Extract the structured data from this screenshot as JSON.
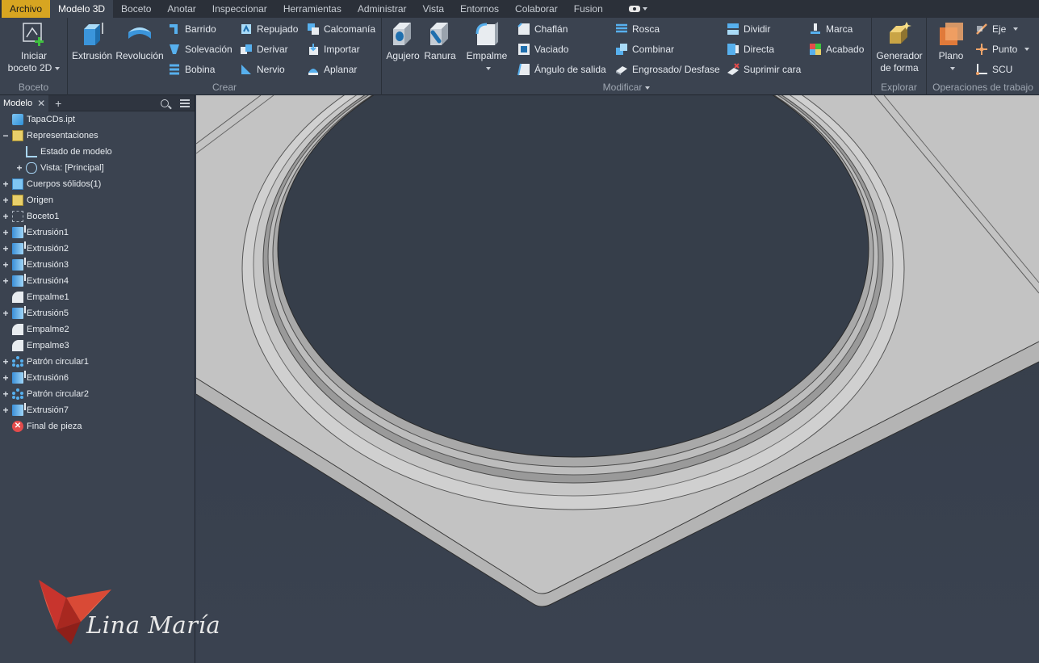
{
  "menu": {
    "tabs": [
      "Archivo",
      "Modelo 3D",
      "Boceto",
      "Anotar",
      "Inspeccionar",
      "Herramientas",
      "Administrar",
      "Vista",
      "Entornos",
      "Colaborar",
      "Fusion"
    ],
    "active_tab": "Modelo 3D",
    "extra_icon": "camera-icon"
  },
  "ribbon": {
    "boceto": {
      "title": "Boceto",
      "start_sketch_line1": "Iniciar",
      "start_sketch_line2": "boceto 2D"
    },
    "crear": {
      "title": "Crear",
      "extrusion": "Extrusión",
      "revolucion": "Revolución",
      "barrido": "Barrido",
      "solevacion": "Solevación",
      "bobina": "Bobina",
      "repujado": "Repujado",
      "derivar": "Derivar",
      "nervio": "Nervio",
      "calcomania": "Calcomanía",
      "importar": "Importar",
      "aplanar": "Aplanar"
    },
    "modificar": {
      "title": "Modificar",
      "agujero": "Agujero",
      "ranura": "Ranura",
      "empalme": "Empalme",
      "chaflan": "Chaflán",
      "vaciado": "Vaciado",
      "angulo": "Ángulo de salida",
      "rosca": "Rosca",
      "combinar": "Combinar",
      "engrosado": "Engrosado/ Desfase",
      "dividir": "Dividir",
      "directa": "Directa",
      "suprimir": "Suprimir cara",
      "marca": "Marca",
      "acabado": "Acabado"
    },
    "explorar": {
      "title": "Explorar",
      "generador_line1": "Generador",
      "generador_line2": "de forma"
    },
    "operaciones": {
      "title": "Operaciones de trabajo",
      "plano": "Plano",
      "eje": "Eje",
      "punto": "Punto",
      "scu": "SCU"
    }
  },
  "browser": {
    "tab_label": "Modelo",
    "tree": [
      {
        "label": "TapaCDs.ipt",
        "icon": "part-icon",
        "expander": ""
      },
      {
        "label": "Representaciones",
        "icon": "folder-icon",
        "expander": "−"
      },
      {
        "label": "Estado de modelo",
        "icon": "model-state-icon",
        "expander": ""
      },
      {
        "label": "Vista: [Principal]",
        "icon": "eye-icon",
        "expander": "+"
      },
      {
        "label": "Cuerpos sólidos(1)",
        "icon": "folder-icon",
        "expander": "+"
      },
      {
        "label": "Origen",
        "icon": "folder-icon",
        "expander": "+"
      },
      {
        "label": "Boceto1",
        "icon": "sketch-icon",
        "expander": "+"
      },
      {
        "label": "Extrusión1",
        "icon": "extrude-icon",
        "expander": "+"
      },
      {
        "label": "Extrusión2",
        "icon": "extrude-icon",
        "expander": "+"
      },
      {
        "label": "Extrusión3",
        "icon": "extrude-icon",
        "expander": "+"
      },
      {
        "label": "Extrusión4",
        "icon": "extrude-icon",
        "expander": "+"
      },
      {
        "label": "Empalme1",
        "icon": "fillet-icon",
        "expander": ""
      },
      {
        "label": "Extrusión5",
        "icon": "extrude-icon",
        "expander": "+"
      },
      {
        "label": "Empalme2",
        "icon": "fillet-icon",
        "expander": ""
      },
      {
        "label": "Empalme3",
        "icon": "fillet-icon",
        "expander": ""
      },
      {
        "label": "Patrón circular1",
        "icon": "circular-pattern-icon",
        "expander": "+"
      },
      {
        "label": "Extrusión6",
        "icon": "extrude-icon",
        "expander": "+"
      },
      {
        "label": "Patrón circular2",
        "icon": "circular-pattern-icon",
        "expander": "+"
      },
      {
        "label": "Extrusión7",
        "icon": "extrude-icon",
        "expander": "+"
      },
      {
        "label": "Final de pieza",
        "icon": "end-of-part-icon",
        "expander": ""
      }
    ]
  },
  "watermark": {
    "text": "Lina María",
    "icon": "butterfly-logo-icon"
  },
  "colors": {
    "file_tab": "#d7a521",
    "ribbon_bg": "#3b4350",
    "viewport_bg": "#38404d",
    "part_face": "#c9c9c9"
  }
}
